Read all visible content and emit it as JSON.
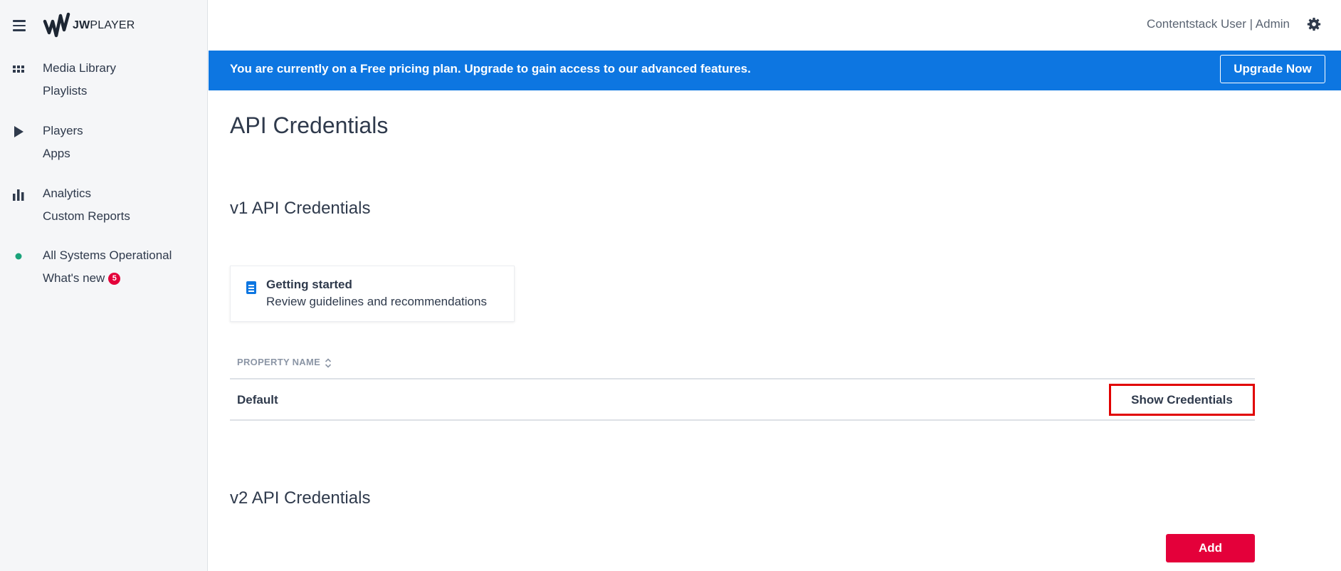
{
  "brand": {
    "logo_bold": "JW",
    "logo_rest": "PLAYER"
  },
  "sidebar": {
    "groups": [
      {
        "icon": "grid-icon",
        "items": [
          "Media Library",
          "Playlists"
        ]
      },
      {
        "icon": "play-icon",
        "items": [
          "Players",
          "Apps"
        ]
      },
      {
        "icon": "bar-chart-icon",
        "items": [
          "Analytics",
          "Custom Reports"
        ]
      },
      {
        "icon": "status-dot-icon",
        "items": [
          "All Systems Operational",
          "What's new"
        ]
      }
    ],
    "whats_new_count": "5",
    "status_color": "#1aa37a"
  },
  "header": {
    "user": "Contentstack User | Admin",
    "settings_icon": "gear-icon"
  },
  "banner": {
    "text": "You are currently on a Free pricing plan. Upgrade to gain access to our advanced features.",
    "button": "Upgrade Now",
    "color": "#0d76e1"
  },
  "main": {
    "title": "API Credentials",
    "v1": {
      "heading": "v1 API Credentials",
      "card": {
        "title": "Getting started",
        "subtitle": "Review guidelines and recommendations"
      },
      "table": {
        "column": "PROPERTY NAME",
        "rows": [
          {
            "name": "Default",
            "action": "Show Credentials"
          }
        ]
      }
    },
    "v2": {
      "heading": "v2 API Credentials",
      "add_button": "Add"
    }
  },
  "colors": {
    "accent": "#e4003a",
    "highlight": "#e10000"
  }
}
